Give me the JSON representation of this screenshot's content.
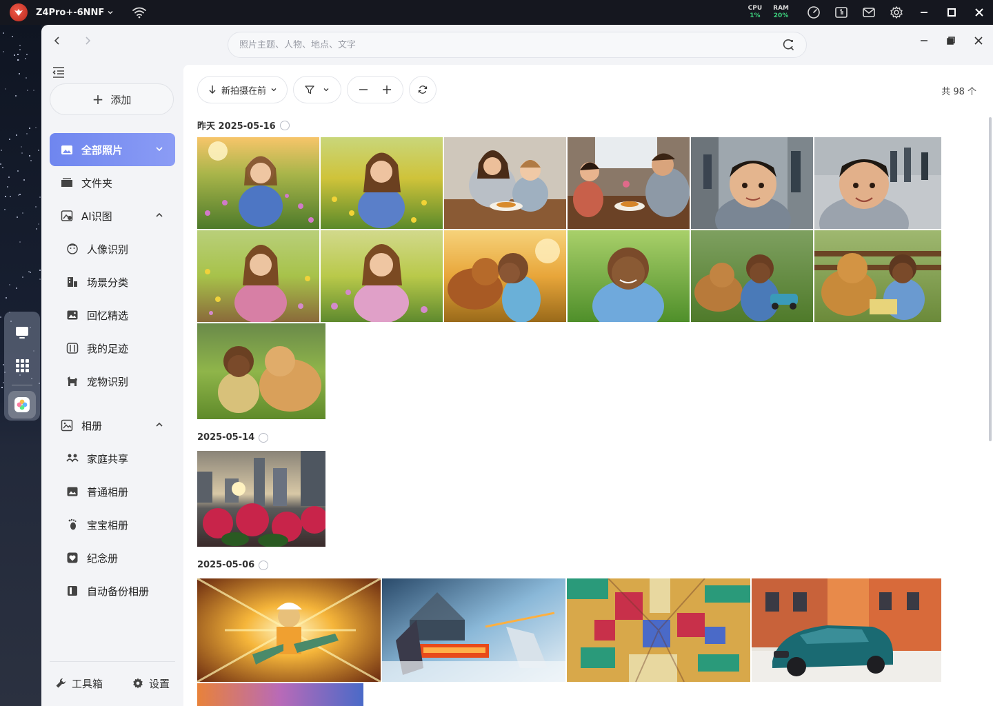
{
  "os": {
    "device_name": "Z4Pro+-6NNF",
    "cpu_label": "CPU",
    "cpu_value": "1%",
    "ram_label": "RAM",
    "ram_value": "20%",
    "icons": [
      "speedometer-icon",
      "monitor-icon",
      "mail-icon",
      "gear-icon",
      "minimize-icon",
      "maximize-icon",
      "close-icon"
    ]
  },
  "search": {
    "placeholder": "照片主题、人物、地点、文字"
  },
  "sidebar": {
    "add_label": "添加",
    "items": [
      {
        "label": "全部照片",
        "icon": "photos-icon",
        "active": true
      },
      {
        "label": "文件夹",
        "icon": "folder-icon"
      },
      {
        "label": "AI识图",
        "icon": "ai-image-icon"
      },
      {
        "label": "人像识别",
        "icon": "face-icon"
      },
      {
        "label": "场景分类",
        "icon": "scene-icon"
      },
      {
        "label": "回忆精选",
        "icon": "memory-icon"
      },
      {
        "label": "我的足迹",
        "icon": "map-icon"
      },
      {
        "label": "宠物识别",
        "icon": "pet-icon"
      },
      {
        "label": "相册",
        "icon": "album-icon"
      },
      {
        "label": "家庭共享",
        "icon": "family-icon"
      },
      {
        "label": "普通相册",
        "icon": "normal-album-icon"
      },
      {
        "label": "宝宝相册",
        "icon": "baby-icon"
      },
      {
        "label": "纪念册",
        "icon": "heart-icon"
      },
      {
        "label": "自动备份相册",
        "icon": "backup-icon"
      }
    ],
    "footer": {
      "toolbox": "工具箱",
      "settings": "设置"
    }
  },
  "toolbar": {
    "sort_label": "新拍摄在前",
    "count_label": "共 98 个"
  },
  "groups": [
    {
      "title": "昨天 2025-05-16"
    },
    {
      "title": "2025-05-14"
    },
    {
      "title": "2025-05-06"
    }
  ],
  "colors": {
    "accent": "#7b8ff2",
    "cpu_green": "#3ccf7c",
    "os_bar": "#15171f"
  }
}
